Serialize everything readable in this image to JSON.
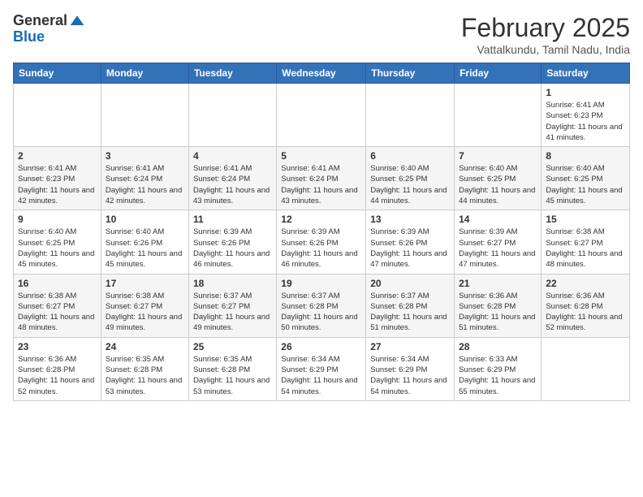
{
  "logo": {
    "general": "General",
    "blue": "Blue"
  },
  "header": {
    "month": "February 2025",
    "location": "Vattalkundu, Tamil Nadu, India"
  },
  "weekdays": [
    "Sunday",
    "Monday",
    "Tuesday",
    "Wednesday",
    "Thursday",
    "Friday",
    "Saturday"
  ],
  "weeks": [
    [
      null,
      null,
      null,
      null,
      null,
      null,
      {
        "day": "1",
        "sunrise": "6:41 AM",
        "sunset": "6:23 PM",
        "daylight": "11 hours and 41 minutes."
      }
    ],
    [
      {
        "day": "2",
        "sunrise": "6:41 AM",
        "sunset": "6:23 PM",
        "daylight": "11 hours and 42 minutes."
      },
      {
        "day": "3",
        "sunrise": "6:41 AM",
        "sunset": "6:24 PM",
        "daylight": "11 hours and 42 minutes."
      },
      {
        "day": "4",
        "sunrise": "6:41 AM",
        "sunset": "6:24 PM",
        "daylight": "11 hours and 43 minutes."
      },
      {
        "day": "5",
        "sunrise": "6:41 AM",
        "sunset": "6:24 PM",
        "daylight": "11 hours and 43 minutes."
      },
      {
        "day": "6",
        "sunrise": "6:40 AM",
        "sunset": "6:25 PM",
        "daylight": "11 hours and 44 minutes."
      },
      {
        "day": "7",
        "sunrise": "6:40 AM",
        "sunset": "6:25 PM",
        "daylight": "11 hours and 44 minutes."
      },
      {
        "day": "8",
        "sunrise": "6:40 AM",
        "sunset": "6:25 PM",
        "daylight": "11 hours and 45 minutes."
      }
    ],
    [
      {
        "day": "9",
        "sunrise": "6:40 AM",
        "sunset": "6:25 PM",
        "daylight": "11 hours and 45 minutes."
      },
      {
        "day": "10",
        "sunrise": "6:40 AM",
        "sunset": "6:26 PM",
        "daylight": "11 hours and 45 minutes."
      },
      {
        "day": "11",
        "sunrise": "6:39 AM",
        "sunset": "6:26 PM",
        "daylight": "11 hours and 46 minutes."
      },
      {
        "day": "12",
        "sunrise": "6:39 AM",
        "sunset": "6:26 PM",
        "daylight": "11 hours and 46 minutes."
      },
      {
        "day": "13",
        "sunrise": "6:39 AM",
        "sunset": "6:26 PM",
        "daylight": "11 hours and 47 minutes."
      },
      {
        "day": "14",
        "sunrise": "6:39 AM",
        "sunset": "6:27 PM",
        "daylight": "11 hours and 47 minutes."
      },
      {
        "day": "15",
        "sunrise": "6:38 AM",
        "sunset": "6:27 PM",
        "daylight": "11 hours and 48 minutes."
      }
    ],
    [
      {
        "day": "16",
        "sunrise": "6:38 AM",
        "sunset": "6:27 PM",
        "daylight": "11 hours and 48 minutes."
      },
      {
        "day": "17",
        "sunrise": "6:38 AM",
        "sunset": "6:27 PM",
        "daylight": "11 hours and 49 minutes."
      },
      {
        "day": "18",
        "sunrise": "6:37 AM",
        "sunset": "6:27 PM",
        "daylight": "11 hours and 49 minutes."
      },
      {
        "day": "19",
        "sunrise": "6:37 AM",
        "sunset": "6:28 PM",
        "daylight": "11 hours and 50 minutes."
      },
      {
        "day": "20",
        "sunrise": "6:37 AM",
        "sunset": "6:28 PM",
        "daylight": "11 hours and 51 minutes."
      },
      {
        "day": "21",
        "sunrise": "6:36 AM",
        "sunset": "6:28 PM",
        "daylight": "11 hours and 51 minutes."
      },
      {
        "day": "22",
        "sunrise": "6:36 AM",
        "sunset": "6:28 PM",
        "daylight": "11 hours and 52 minutes."
      }
    ],
    [
      {
        "day": "23",
        "sunrise": "6:36 AM",
        "sunset": "6:28 PM",
        "daylight": "11 hours and 52 minutes."
      },
      {
        "day": "24",
        "sunrise": "6:35 AM",
        "sunset": "6:28 PM",
        "daylight": "11 hours and 53 minutes."
      },
      {
        "day": "25",
        "sunrise": "6:35 AM",
        "sunset": "6:28 PM",
        "daylight": "11 hours and 53 minutes."
      },
      {
        "day": "26",
        "sunrise": "6:34 AM",
        "sunset": "6:29 PM",
        "daylight": "11 hours and 54 minutes."
      },
      {
        "day": "27",
        "sunrise": "6:34 AM",
        "sunset": "6:29 PM",
        "daylight": "11 hours and 54 minutes."
      },
      {
        "day": "28",
        "sunrise": "6:33 AM",
        "sunset": "6:29 PM",
        "daylight": "11 hours and 55 minutes."
      },
      null
    ]
  ]
}
